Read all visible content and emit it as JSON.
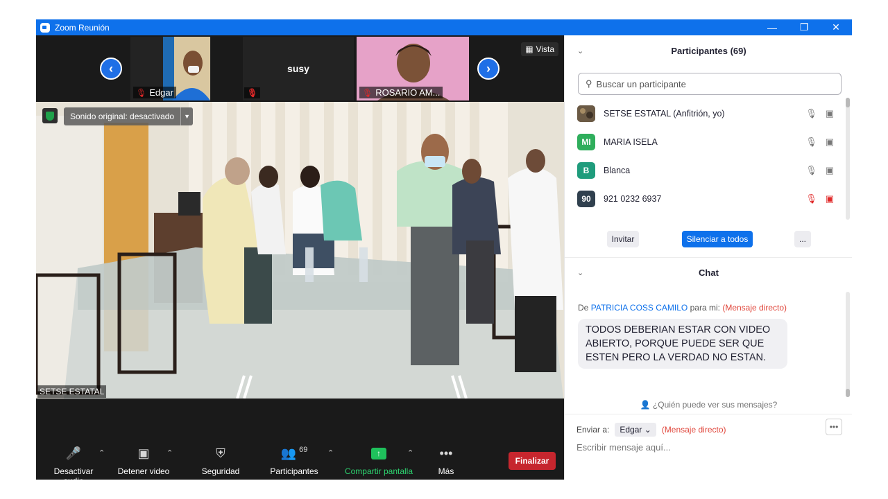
{
  "window": {
    "title": "Zoom Reunión"
  },
  "video_strip": {
    "tiles": [
      {
        "name": "Edgar"
      },
      {
        "name": "susy"
      },
      {
        "name": "ROSARIO AM..."
      }
    ],
    "view_label": "Vista"
  },
  "main_video": {
    "original_sound": "Sonido original: desactivado",
    "speaker_name": "SETSE ESTATAL"
  },
  "toolbar": {
    "mute_audio": "Desactivar audio",
    "stop_video": "Detener video",
    "security": "Seguridad",
    "participants": "Participantes",
    "participants_count": "69",
    "share_screen": "Compartir pantalla",
    "more": "Más",
    "end": "Finalizar"
  },
  "participants_panel": {
    "title": "Participantes (69)",
    "search_placeholder": "Buscar un participante",
    "participants": [
      {
        "name": "SETSE ESTATAL (Anfitrión, yo)",
        "avatar": "",
        "color": "#6b5a45",
        "muted": false
      },
      {
        "name": "MARIA ISELA",
        "avatar": "MI",
        "color": "#2fae5c",
        "muted": false
      },
      {
        "name": "Blanca",
        "avatar": "B",
        "color": "#1f9c7c",
        "muted": false
      },
      {
        "name": "921 0232 6937",
        "avatar": "90",
        "color": "#30404e",
        "muted": true
      }
    ],
    "invite": "Invitar",
    "mute_all": "Silenciar a todos",
    "more": "..."
  },
  "chat": {
    "title": "Chat",
    "from_prefix": "De",
    "sender": "PATRICIA COSS CAMILO",
    "to_me": "para mi:",
    "direct_tag": "(Mensaje directo)",
    "message": "TODOS DEBERIAN ESTAR CON VIDEO ABIERTO, PORQUE PUEDE SER QUE ESTEN PERO LA VERDAD NO ESTAN.",
    "who_can_see": "¿Quién puede ver sus mensajes?",
    "send_to_label": "Enviar a:",
    "send_to_value": "Edgar",
    "send_to_dm": "(Mensaje directo)",
    "input_placeholder": "Escribir mensaje aquí..."
  }
}
